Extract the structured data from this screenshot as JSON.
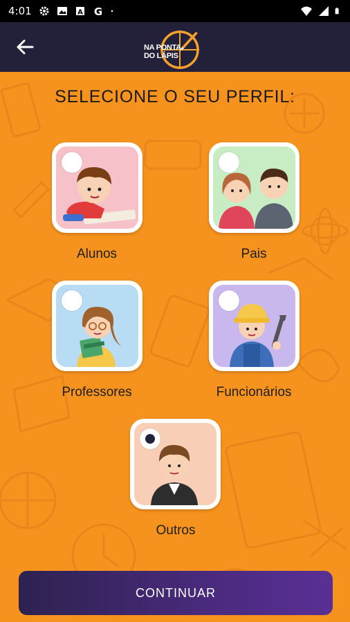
{
  "status_bar": {
    "time": "4:01",
    "icons": [
      "gear-icon",
      "photo-icon",
      "a-box-icon",
      "google-g-icon",
      "dot-icon",
      "wifi-icon",
      "signal-icon",
      "battery-icon"
    ]
  },
  "app_bar": {
    "back_icon": "arrow-left-icon",
    "logo": {
      "line1": "NA PONTA",
      "line2": "DO LÁPIS"
    }
  },
  "heading": "SELECIONE O SEU PERFIL:",
  "profiles": [
    {
      "label": "Alunos",
      "bg": "#f6c1c8",
      "selected": false
    },
    {
      "label": "Pais",
      "bg": "#c8edc4",
      "selected": false
    },
    {
      "label": "Professores",
      "bg": "#b8dcf4",
      "selected": false
    },
    {
      "label": "Funcionários",
      "bg": "#c9b8ee",
      "selected": false
    },
    {
      "label": "Outros",
      "bg": "#f8cfb6",
      "selected": true
    }
  ],
  "continue_label": "CONTINUAR",
  "colors": {
    "background": "#f6931e",
    "app_bar": "#23213a",
    "button_start": "#2d2250",
    "button_end": "#5a2f95"
  }
}
